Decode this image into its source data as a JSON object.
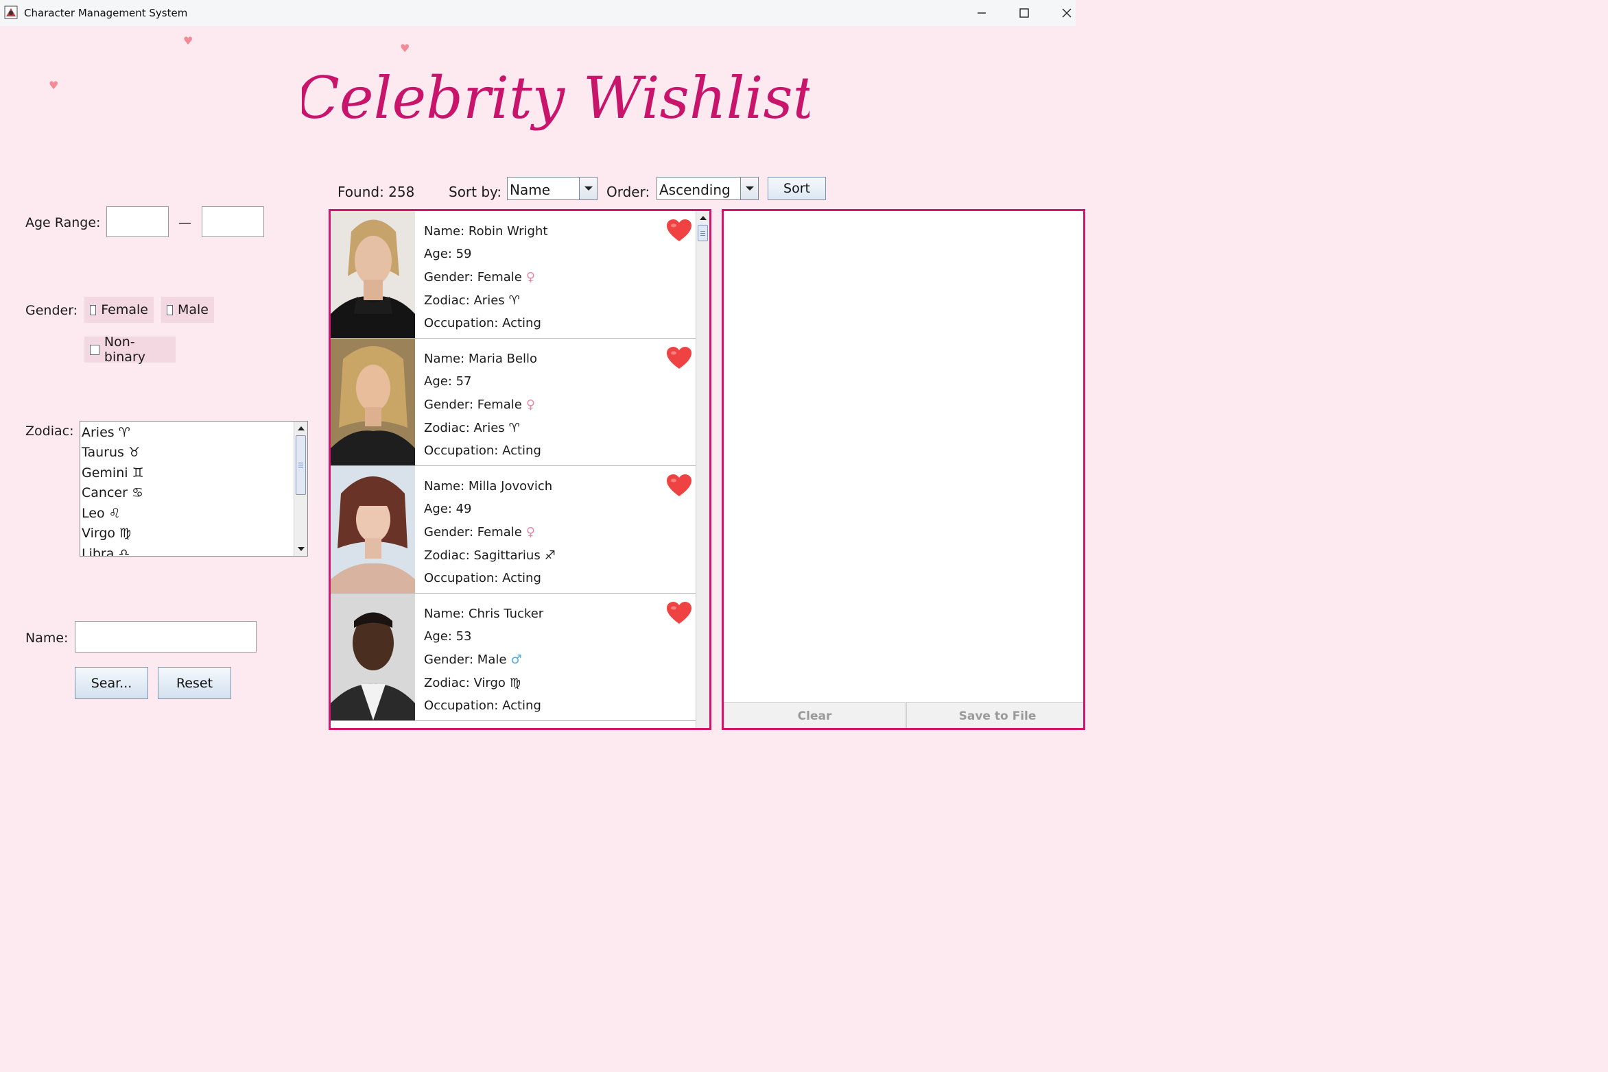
{
  "window": {
    "title": "Character Management System",
    "controls": [
      "minimize-icon",
      "maximize-icon",
      "close-icon"
    ]
  },
  "header": {
    "logo_text": "Celebrity Wishlist"
  },
  "filters": {
    "age_range_label": "Age Range:",
    "age_separator": "—",
    "age_min_value": "",
    "age_max_value": "",
    "gender_label": "Gender:",
    "gender_options": [
      {
        "label": "Female",
        "checked": false
      },
      {
        "label": "Male",
        "checked": false
      },
      {
        "label": "Non-binary",
        "checked": false
      }
    ],
    "zodiac_label": "Zodiac:",
    "zodiac_options": [
      "Aries ♈",
      "Taurus ♉",
      "Gemini ♊",
      "Cancer ♋",
      "Leo ♌",
      "Virgo ♍",
      "Libra ♎"
    ],
    "name_label": "Name:",
    "name_value": "",
    "search_button": "Sear...",
    "reset_button": "Reset"
  },
  "toolbar": {
    "found_text": "Found: 258",
    "sort_by_label": "Sort by:",
    "sort_by_value": "Name",
    "order_label": "Order:",
    "order_value": "Ascending",
    "sort_button": "Sort"
  },
  "results": [
    {
      "name": "Name: Robin Wright",
      "age": "Age: 59",
      "gender": "Gender: Female",
      "gender_symbol": "♀",
      "zodiac": "Zodiac: Aries",
      "zodiac_symbol": "♈",
      "occupation": "Occupation: Acting"
    },
    {
      "name": "Name: Maria Bello",
      "age": "Age: 57",
      "gender": "Gender: Female",
      "gender_symbol": "♀",
      "zodiac": "Zodiac: Aries",
      "zodiac_symbol": "♈",
      "occupation": "Occupation: Acting"
    },
    {
      "name": "Name: Milla Jovovich",
      "age": "Age: 49",
      "gender": "Gender: Female",
      "gender_symbol": "♀",
      "zodiac": "Zodiac: Sagittarius",
      "zodiac_symbol": "♐",
      "occupation": "Occupation: Acting"
    },
    {
      "name": "Name: Chris Tucker",
      "age": "Age: 53",
      "gender": "Gender: Male",
      "gender_symbol": "♂",
      "zodiac": "Zodiac: Virgo",
      "zodiac_symbol": "♍",
      "occupation": "Occupation: Acting"
    }
  ],
  "detail_panel": {
    "clear_button": "Clear",
    "save_button": "Save to File"
  },
  "colors": {
    "accent": "#d2156f",
    "logo": "#c8156b",
    "background": "#fdeaf1",
    "heart": "#ef4343",
    "female_symbol": "#e88aa8",
    "male_symbol": "#4aa8e0"
  }
}
